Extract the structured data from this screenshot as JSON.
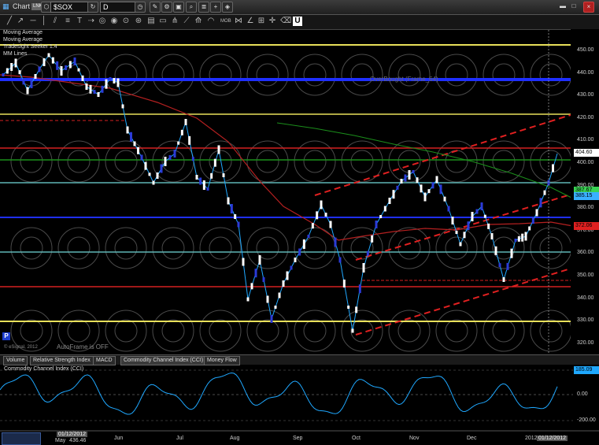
{
  "window": {
    "title": "Chart",
    "badge": "LNK",
    "symbol": "$SOX",
    "interval": "D"
  },
  "studies": [
    "Moving Average",
    "Moving Average",
    "Tradesight Seeker 1.4",
    "MM Lines"
  ],
  "chart": {
    "overbought_label": "OverBought (Frame_64)",
    "copyright": "© eSignal, 2012",
    "autoframe": "AutoFrame is OFF",
    "p_button": "P"
  },
  "price_axis": [
    "450.00",
    "440.00",
    "430.00",
    "420.00",
    "410.00",
    "400.00",
    "390.00",
    "380.00",
    "370.00",
    "360.00",
    "350.00",
    "340.00",
    "330.00",
    "320.00"
  ],
  "price_tags": [
    {
      "value": "404.60",
      "color": "#ffffff"
    },
    {
      "value": "387.67",
      "color": "#39d353"
    },
    {
      "value": "385.15",
      "color": "#39b0ff"
    },
    {
      "value": "372.06",
      "color": "#e02020"
    }
  ],
  "tabs": [
    "Volume",
    "Relative Strength Index",
    "MACD",
    "Commodity Channel Index (CCI)",
    "Money Flow"
  ],
  "cci": {
    "label": "Commodity Channel Index (CCI)",
    "axis": [
      "0.00",
      "-200.00"
    ],
    "tag": "185.09"
  },
  "months": [
    "Jun",
    "Jul",
    "Aug",
    "Sep",
    "Oct",
    "Nov",
    "Dec",
    "2012",
    "01/12/2012"
  ],
  "bottom": {
    "date1": "01/12/2012",
    "date2": "May",
    "value": "436.46"
  },
  "colors": {
    "yellow": "#e8e05a",
    "blue": "#1f2fff",
    "red": "#d42020",
    "green": "#1b8f1b",
    "teal": "#5fb5b5",
    "cyan": "#1fa8ff"
  }
}
